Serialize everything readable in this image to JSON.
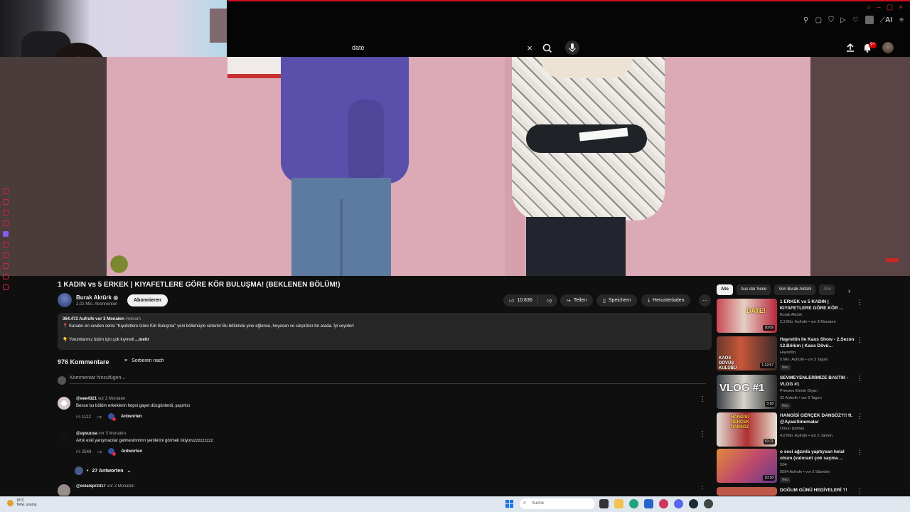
{
  "browser": {
    "window_controls": [
      "⌕",
      "–",
      "▢",
      "×"
    ],
    "extension_icons": [
      "pin-icon",
      "tab-icon",
      "shield-icon",
      "play-icon",
      "heart-icon",
      "extension-avatar",
      "ai-icon",
      "menu-icon"
    ],
    "ai_label": "AI"
  },
  "header": {
    "search_value": "date",
    "notification_badge": "9+"
  },
  "video": {
    "title": "1 KADIN vs 5 ERKEK | KIYAFETLERE GÖRE KÖR BULUŞMA! (BEKLENEN BÖLÜM!)",
    "channel": "Burak Aktürk",
    "subscribers": "2,02 Mio. Abonnenten",
    "subscribe_label": "Abonnieren",
    "likes": "10.836",
    "share_label": "Teilen",
    "save_label": "Speichern",
    "download_label": "Herunterladen"
  },
  "description": {
    "stats": "364.472 Aufrufe  vor 3 Monaten",
    "tag": "#reklam",
    "line1": "📍 Kanalın en sevilen serisi \"Kıyafetlere Göre Kör Buluşma\" yeni bölümüyle sizlerle! Bu bölümde yine eğlence, heyecan ve sürprizler bir arada. İyi seyirler!",
    "line2": "👇 Yorumlarınız bizim için çok kıymetl",
    "more": "...mehr"
  },
  "comments": {
    "count": "976 Kommentare",
    "sort_label": "Sortieren nach",
    "add_placeholder": "Kommentar hinzufügen...",
    "reply_label": "Antworten",
    "items": [
      {
        "author": "@eee4321",
        "time": "vor 3 Monaten",
        "text": "Bence bu bölüm erkeklerin hepsi gayet düzgünlerdi, şaşırtıcı",
        "likes": "1122"
      },
      {
        "author": "@aysuusa",
        "time": "vor 3 Monaten",
        "text": "Artık eski yarışmacılar gelmesinnnnn yenilerini görmek istiyoruzzzzzzzzz",
        "likes": "2548"
      },
      {
        "author": "@eclalspr2417",
        "time": "vor 3 Monaten",
        "text": "",
        "likes": ""
      }
    ],
    "replies_label": "27 Antworten"
  },
  "sidebar": {
    "chips": [
      "Alle",
      "Aus der Serie",
      "Von Burak Aktürk",
      "Ähn"
    ],
    "recommendations": [
      {
        "title": "1 ERKEK vs 5 KADIN | KIYAFETLERE GÖRE KÖR ...",
        "channel": "Burak Aktürk",
        "meta": "2,3 Mio. Aufrufe • vor 8 Monaten",
        "duration": "20:09",
        "thumb_text": "DATE!",
        "new": ""
      },
      {
        "title": "Hayrettin ile Kaos Show - 2.Sezon 12.Bölüm | Kaos Dövü...",
        "channel": "Hayrettin",
        "meta": "5 Mio. Aufrufe • vor 3 Tagen",
        "duration": "1:12:57",
        "thumb_text": "KAOS DÖVÜŞ KULÜBÜ",
        "new": "Neu"
      },
      {
        "title": "SEVMEYENLERİMİZE BASTIK - VLOG #1",
        "channel": "Prenses Elenin Diyarı",
        "meta": "32 Aufrufe • vor 2 Tagen",
        "duration": "3:18",
        "thumb_text": "VLOG #1",
        "new": "Neu"
      },
      {
        "title": "HANGİSİ GERÇEK DANSÖZ?!! ft. @AyasiSinemalar",
        "channel": "Orkun Işıtmak",
        "meta": "4,8 Mio. Aufrufe • vor 2 Jahren",
        "duration": "51:11",
        "thumb_text": "HANGİSİ GERÇEK DANSÖZ",
        "new": ""
      },
      {
        "title": "o sesi ağzınla yaptıysan helal olsun (valorant çok saçma ...",
        "channel": "S04",
        "meta": "5594 Aufrufe • vor 2 Stunden",
        "duration": "10:18",
        "thumb_text": "",
        "new": "Neu"
      },
      {
        "title": "DOĞUM GÜNÜ HEDİYELERİ ?!",
        "channel": "",
        "meta": "",
        "duration": "",
        "thumb_text": "",
        "new": ""
      }
    ]
  },
  "taskbar": {
    "weather_temp": "18°C",
    "weather_desc": "Teilw. sonnig",
    "search_placeholder": "Suche"
  },
  "colors": {
    "background": "#0f0f0f",
    "accent_red": "#cc0000",
    "pill": "#272727"
  }
}
